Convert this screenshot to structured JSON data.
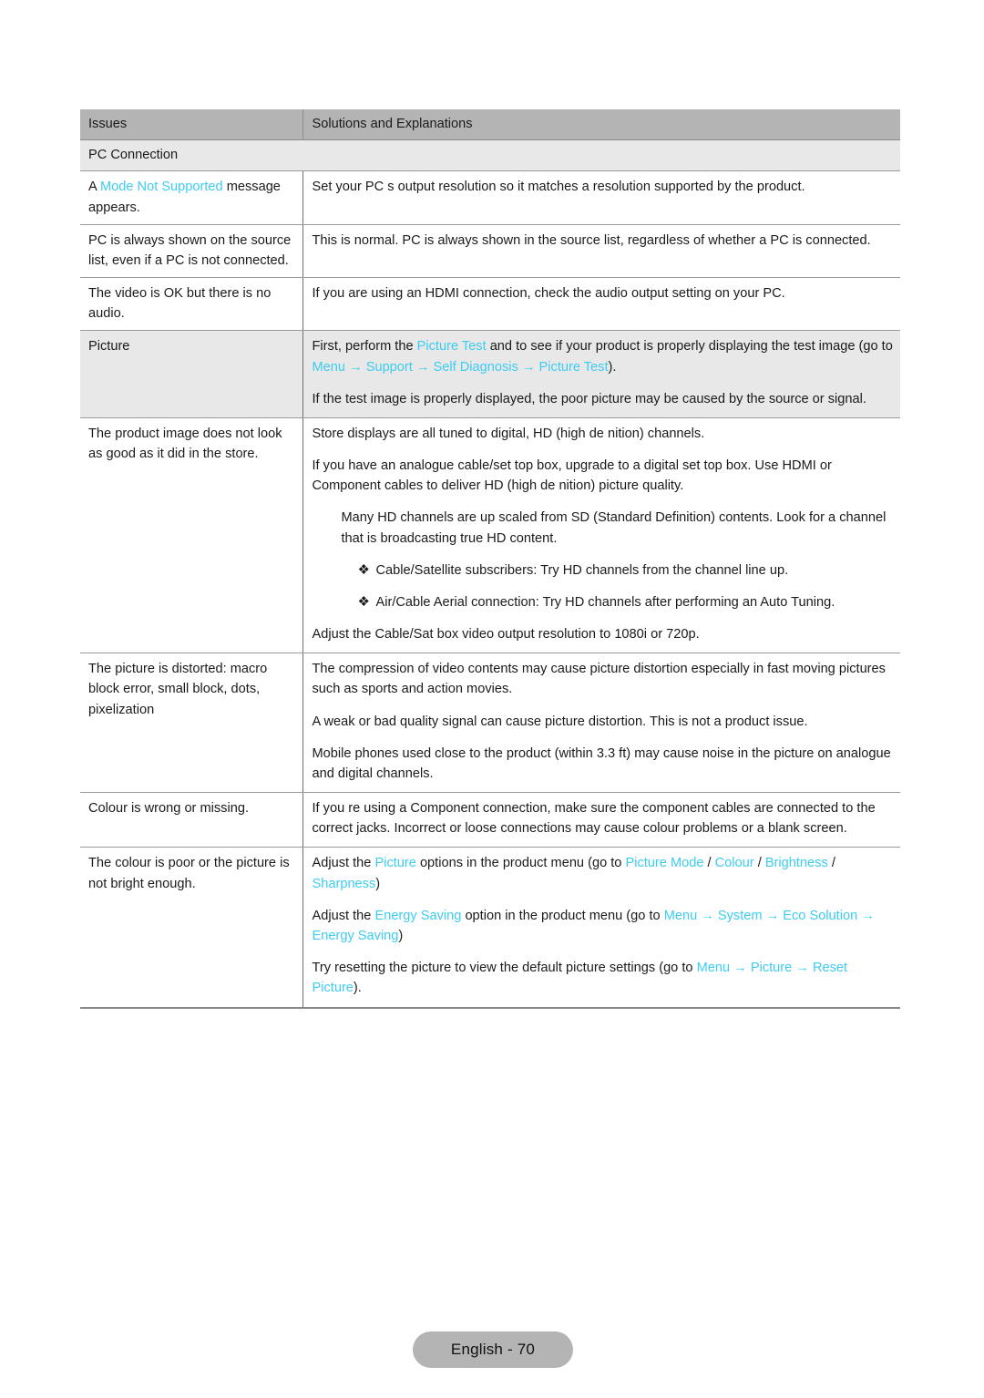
{
  "page": {
    "footer_label": "English - 70",
    "link_color": "#3dccf2",
    "header_bg": "#b4b4b4",
    "shaded_bg": "#e8e8e8"
  },
  "table": {
    "headers": {
      "issues": "Issues",
      "solutions": "Solutions and Explanations"
    },
    "section_title": "PC Connection",
    "rows": [
      {
        "issue_parts": [
          {
            "t": "A ",
            "k": "plain"
          },
          {
            "t": "Mode Not Supported",
            "k": "link"
          },
          {
            "t": " message appears.",
            "k": "plain"
          }
        ],
        "solution_paras": [
          {
            "indent": "none",
            "parts": [
              {
                "t": "Set your PC s output resolution so it matches a resolution supported by the product.",
                "k": "plain"
              }
            ]
          }
        ]
      },
      {
        "issue_parts": [
          {
            "t": " PC  is always shown on the source list, even if a PC is not connected.",
            "k": "plain"
          }
        ],
        "solution_paras": [
          {
            "indent": "none",
            "parts": [
              {
                "t": "This is normal.  PC  is always shown in the source list, regardless of whether a PC is connected.",
                "k": "plain"
              }
            ]
          }
        ]
      },
      {
        "issue_parts": [
          {
            "t": "The video is OK but there is no audio.",
            "k": "plain"
          }
        ],
        "solution_paras": [
          {
            "indent": "none",
            "parts": [
              {
                "t": "If you are using an HDMI connection, check the audio output setting on your PC.",
                "k": "plain"
              }
            ]
          }
        ]
      },
      {
        "shaded": true,
        "issue_parts": [
          {
            "t": "Picture",
            "k": "plain"
          }
        ],
        "solution_paras": [
          {
            "indent": "none",
            "parts": [
              {
                "t": "First, perform the ",
                "k": "plain"
              },
              {
                "t": "Picture Test",
                "k": "link"
              },
              {
                "t": " and to see if your product is properly displaying the test image (go to ",
                "k": "plain"
              },
              {
                "t": "Menu",
                "k": "link"
              },
              {
                "t": " → ",
                "k": "arrow"
              },
              {
                "t": "Support",
                "k": "link"
              },
              {
                "t": " → ",
                "k": "arrow"
              },
              {
                "t": "Self Diagnosis",
                "k": "link"
              },
              {
                "t": " → ",
                "k": "arrow"
              },
              {
                "t": "Picture Test",
                "k": "link"
              },
              {
                "t": ").",
                "k": "plain"
              }
            ]
          },
          {
            "indent": "none",
            "parts": [
              {
                "t": "If the test image is properly displayed, the poor picture may be caused by the source or signal.",
                "k": "plain"
              }
            ]
          }
        ]
      },
      {
        "issue_parts": [
          {
            "t": "The product image does not look as good as it did in the store.",
            "k": "plain"
          }
        ],
        "solution_paras": [
          {
            "indent": "none",
            "parts": [
              {
                "t": "Store displays are all tuned to digital, HD (high de nition) channels.",
                "k": "plain"
              }
            ]
          },
          {
            "indent": "none",
            "parts": [
              {
                "t": "If you have an analogue cable/set top box, upgrade to a digital set top box. Use HDMI or Component cables to deliver HD (high de nition) picture quality.",
                "k": "plain"
              }
            ]
          },
          {
            "indent": "indent1",
            "parts": [
              {
                "t": "Many HD channels are up scaled from SD (Standard Definition) contents. Look for a channel that is broadcasting true HD content.",
                "k": "plain"
              }
            ]
          },
          {
            "indent": "bullet",
            "bullet": "❖",
            "parts": [
              {
                "t": "Cable/Satellite subscribers: Try HD channels from the channel line up.",
                "k": "plain"
              }
            ]
          },
          {
            "indent": "bullet",
            "bullet": "❖",
            "parts": [
              {
                "t": "Air/Cable Aerial connection: Try HD channels after performing an Auto Tuning.",
                "k": "plain"
              }
            ]
          },
          {
            "indent": "none",
            "parts": [
              {
                "t": "Adjust the Cable/Sat box video output resolution to 1080i or 720p.",
                "k": "plain"
              }
            ]
          }
        ]
      },
      {
        "issue_parts": [
          {
            "t": "The picture is distorted: macro block error, small block, dots, pixelization",
            "k": "plain"
          }
        ],
        "solution_paras": [
          {
            "indent": "none",
            "parts": [
              {
                "t": "The compression of video contents may cause picture distortion especially in fast moving pictures such as sports and action movies.",
                "k": "plain"
              }
            ]
          },
          {
            "indent": "none",
            "parts": [
              {
                "t": "A weak or bad quality signal can cause picture distortion. This is not a product issue.",
                "k": "plain"
              }
            ]
          },
          {
            "indent": "none",
            "parts": [
              {
                "t": "Mobile phones used close to the product (within 3.3 ft) may cause noise in the picture on analogue and digital channels.",
                "k": "plain"
              }
            ]
          }
        ]
      },
      {
        "issue_parts": [
          {
            "t": "Colour is wrong or missing.",
            "k": "plain"
          }
        ],
        "solution_paras": [
          {
            "indent": "none",
            "parts": [
              {
                "t": "If you re using a Component connection, make sure the component cables are connected to the correct jacks. Incorrect or loose connections may cause colour problems or a blank screen.",
                "k": "plain"
              }
            ]
          }
        ]
      },
      {
        "last": true,
        "issue_parts": [
          {
            "t": "The colour is poor or the picture is not bright enough.",
            "k": "plain"
          }
        ],
        "solution_paras": [
          {
            "indent": "none",
            "parts": [
              {
                "t": "Adjust the ",
                "k": "plain"
              },
              {
                "t": "Picture",
                "k": "link"
              },
              {
                "t": " options in the product menu (go to ",
                "k": "plain"
              },
              {
                "t": "Picture Mode",
                "k": "link"
              },
              {
                "t": " / ",
                "k": "plain"
              },
              {
                "t": "Colour",
                "k": "link"
              },
              {
                "t": " / ",
                "k": "plain"
              },
              {
                "t": "Brightness",
                "k": "link"
              },
              {
                "t": " / ",
                "k": "plain"
              },
              {
                "t": "Sharpness",
                "k": "link"
              },
              {
                "t": ")",
                "k": "plain"
              }
            ]
          },
          {
            "indent": "none",
            "parts": [
              {
                "t": "Adjust the ",
                "k": "plain"
              },
              {
                "t": "Energy Saving",
                "k": "link"
              },
              {
                "t": " option in the product menu (go to ",
                "k": "plain"
              },
              {
                "t": "Menu",
                "k": "link"
              },
              {
                "t": " → ",
                "k": "arrow"
              },
              {
                "t": "System",
                "k": "link"
              },
              {
                "t": " → ",
                "k": "arrow"
              },
              {
                "t": "Eco Solution",
                "k": "link"
              },
              {
                "t": " → ",
                "k": "arrow"
              },
              {
                "t": "Energy Saving",
                "k": "link"
              },
              {
                "t": ")",
                "k": "plain"
              }
            ]
          },
          {
            "indent": "none",
            "parts": [
              {
                "t": "Try resetting the picture to view the default picture settings (go to ",
                "k": "plain"
              },
              {
                "t": "Menu",
                "k": "link"
              },
              {
                "t": " → ",
                "k": "arrow"
              },
              {
                "t": "Picture",
                "k": "link"
              },
              {
                "t": " → ",
                "k": "arrow"
              },
              {
                "t": "Reset Picture",
                "k": "link"
              },
              {
                "t": ").",
                "k": "plain"
              }
            ]
          }
        ]
      }
    ]
  }
}
